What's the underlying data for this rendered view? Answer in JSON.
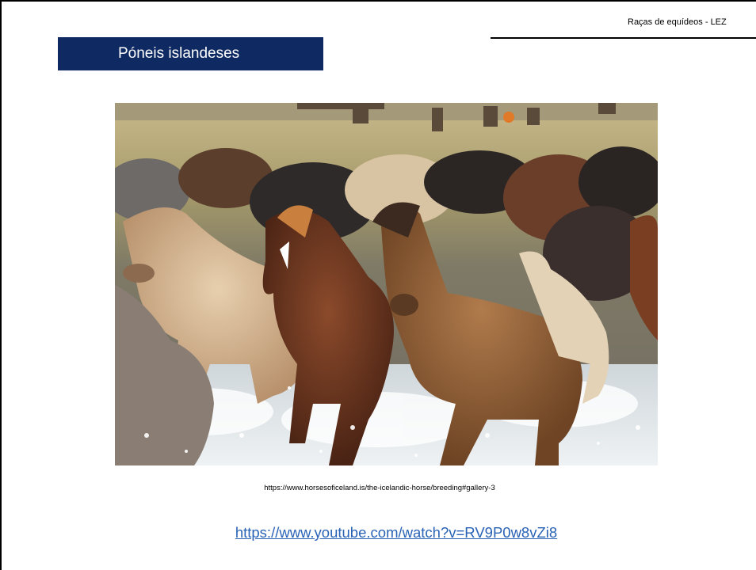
{
  "header": {
    "text": "Raças de equídeos  -  LEZ"
  },
  "slide": {
    "title": "Póneis islandeses",
    "image_description": "Herd of Icelandic horses running through splashing water",
    "image_caption": "https://www.horsesoficeland.is/the-icelandic-horse/breeding#gallery-3",
    "video_link": "https://www.youtube.com/watch?v=RV9P0w8vZi8"
  },
  "colors": {
    "title_bg": "#0f2a63",
    "title_text": "#ffffff",
    "link": "#2a63b6"
  }
}
